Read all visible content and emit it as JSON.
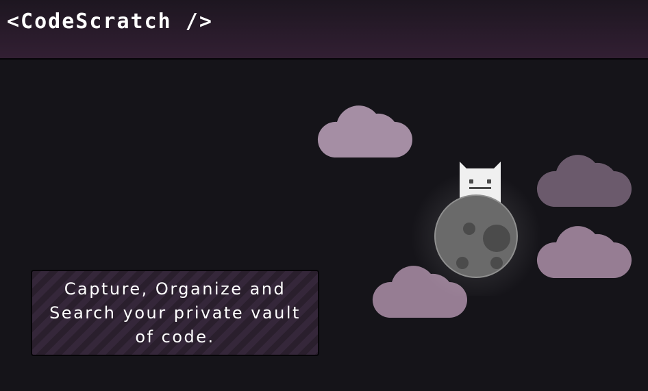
{
  "header": {
    "logo_text": "<CodeScratch />"
  },
  "hero": {
    "tagline": "Capture, Organize and Search your private vault of code.",
    "illustration": {
      "character_icon": "cat-on-moon-icon",
      "cloud_icon": "cloud-icon"
    }
  },
  "colors": {
    "header_top": "#1d1620",
    "header_bottom": "#321f33",
    "background": "#151419",
    "cloud_light": "#a58ea4",
    "cloud_mid": "#967d93",
    "cloud_dark": "#6b5a6c",
    "moon": "#6a6a6a",
    "moon_crater": "#4b4b4b",
    "cat": "#f0f0f0",
    "tagline_stripe_a": "#2a1f2d",
    "tagline_stripe_b": "#35273a"
  }
}
